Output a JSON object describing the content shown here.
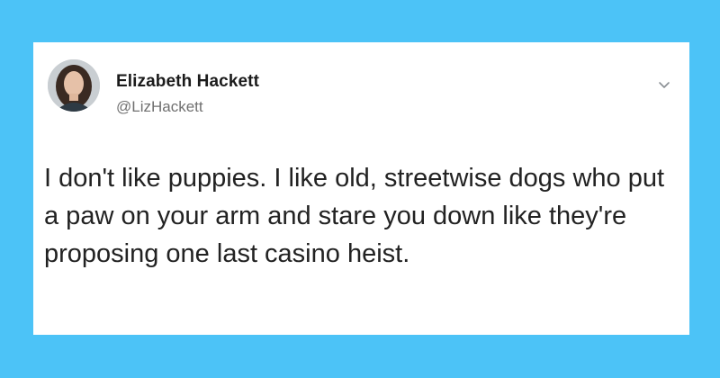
{
  "tweet": {
    "author": {
      "display_name": "Elizabeth Hackett",
      "handle": "@LizHackett",
      "avatar_icon": "avatar-photo"
    },
    "menu_icon": "chevron-down-icon",
    "text": "I don't like puppies. I like old, streetwise dogs who put a paw on your arm and stare you down like they're proposing one last casino heist."
  },
  "colors": {
    "background": "#4cc3f7",
    "card": "#ffffff",
    "name_text": "#1b1b1b",
    "handle_text": "#707070",
    "body_text": "#222222"
  }
}
